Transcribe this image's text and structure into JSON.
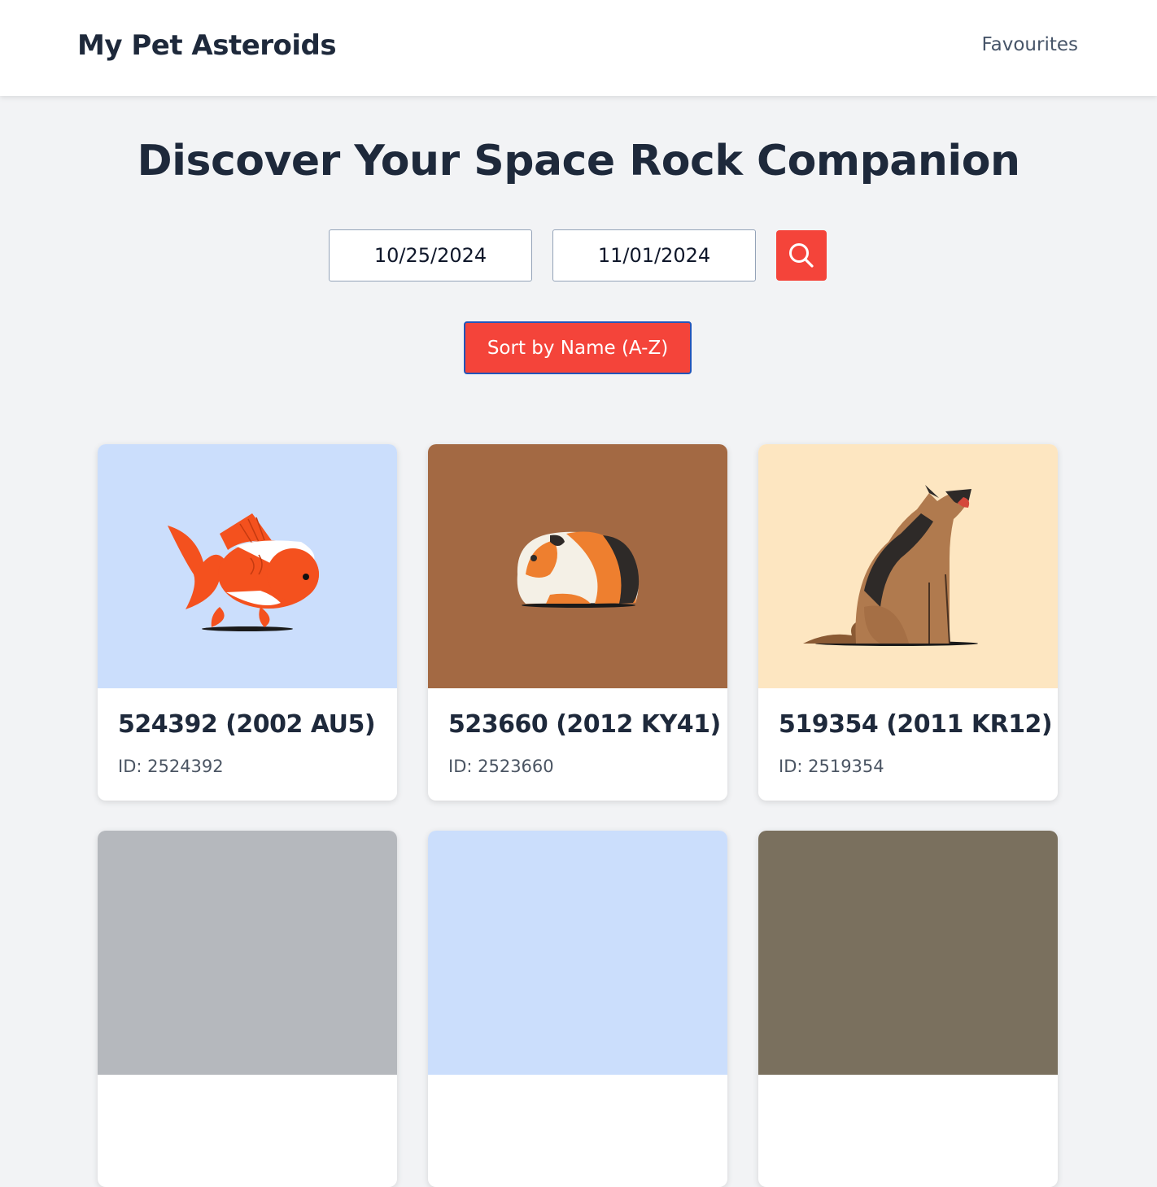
{
  "header": {
    "brand": "My Pet Asteroids",
    "nav_favourites": "Favourites"
  },
  "hero": {
    "title": "Discover Your Space Rock Companion"
  },
  "search": {
    "start_date": "10/25/2024",
    "end_date": "11/01/2024",
    "search_icon": "search-icon"
  },
  "sort": {
    "label": "Sort by Name (A-Z)"
  },
  "colors": {
    "accent": "#f4443a",
    "sort_border": "#2455b8",
    "text_dark": "#1e293b",
    "page_bg": "#f2f3f5"
  },
  "cards": [
    {
      "title": "524392 (2002 AU5)",
      "id_text": "ID: 2524392",
      "image": "goldfish-illustration",
      "bg": "#cbdefc"
    },
    {
      "title": "523660 (2012 KY41)",
      "id_text": "ID: 2523660",
      "image": "guinea-pig-illustration",
      "bg": "#a36943"
    },
    {
      "title": "519354 (2011 KR12)",
      "id_text": "ID: 2519354",
      "image": "german-shepherd-illustration",
      "bg": "#fde6c1"
    },
    {
      "title": "",
      "id_text": "",
      "image": "",
      "bg": "#b5b8bd"
    },
    {
      "title": "",
      "id_text": "",
      "image": "",
      "bg": "#cbdefc"
    },
    {
      "title": "",
      "id_text": "",
      "image": "",
      "bg": "#7a705e"
    }
  ]
}
